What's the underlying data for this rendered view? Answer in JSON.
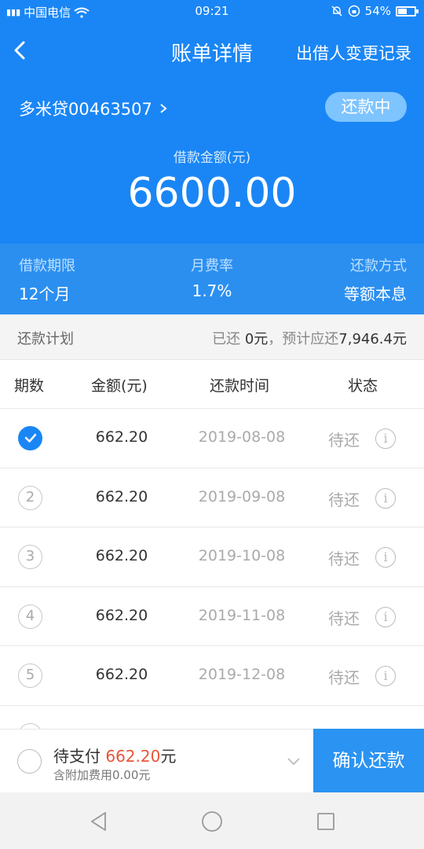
{
  "status_bar": {
    "carrier": "中国电信",
    "time": "09:21",
    "battery": "54%",
    "battery_level": 0.54
  },
  "header": {
    "title": "账单详情",
    "right_action": "出借人变更记录"
  },
  "loan": {
    "product": "多米贷00463507",
    "status": "还款中",
    "amount_label": "借款金额(元)",
    "amount": "6600.00"
  },
  "terms": [
    {
      "label": "借款期限",
      "value": "12个月"
    },
    {
      "label": "月费率",
      "value": "1.7%"
    },
    {
      "label": "还款方式",
      "value": "等额本息"
    }
  ],
  "plan": {
    "title": "还款计划",
    "paid_prefix": "已还",
    "paid_amount": "0元",
    "expected": "，预计应还",
    "expected_amount": "7,946.4元"
  },
  "table": {
    "headers": [
      "期数",
      "金额(元)",
      "还款时间",
      "状态"
    ],
    "rows": [
      {
        "num": "",
        "amount": "662.20",
        "date": "2019-08-08",
        "state": "待还",
        "checked": true
      },
      {
        "num": "2",
        "amount": "662.20",
        "date": "2019-09-08",
        "state": "待还",
        "checked": false
      },
      {
        "num": "3",
        "amount": "662.20",
        "date": "2019-10-08",
        "state": "待还",
        "checked": false
      },
      {
        "num": "4",
        "amount": "662.20",
        "date": "2019-11-08",
        "state": "待还",
        "checked": false
      },
      {
        "num": "5",
        "amount": "662.20",
        "date": "2019-12-08",
        "state": "待还",
        "checked": false
      }
    ]
  },
  "payment": {
    "label": "待支付",
    "amount": "662.20",
    "unit": "元",
    "extra": "含附加费用0.00元",
    "confirm": "确认还款"
  },
  "colors": {
    "primary": "#1a86f5",
    "accent_red": "#e9543a"
  }
}
